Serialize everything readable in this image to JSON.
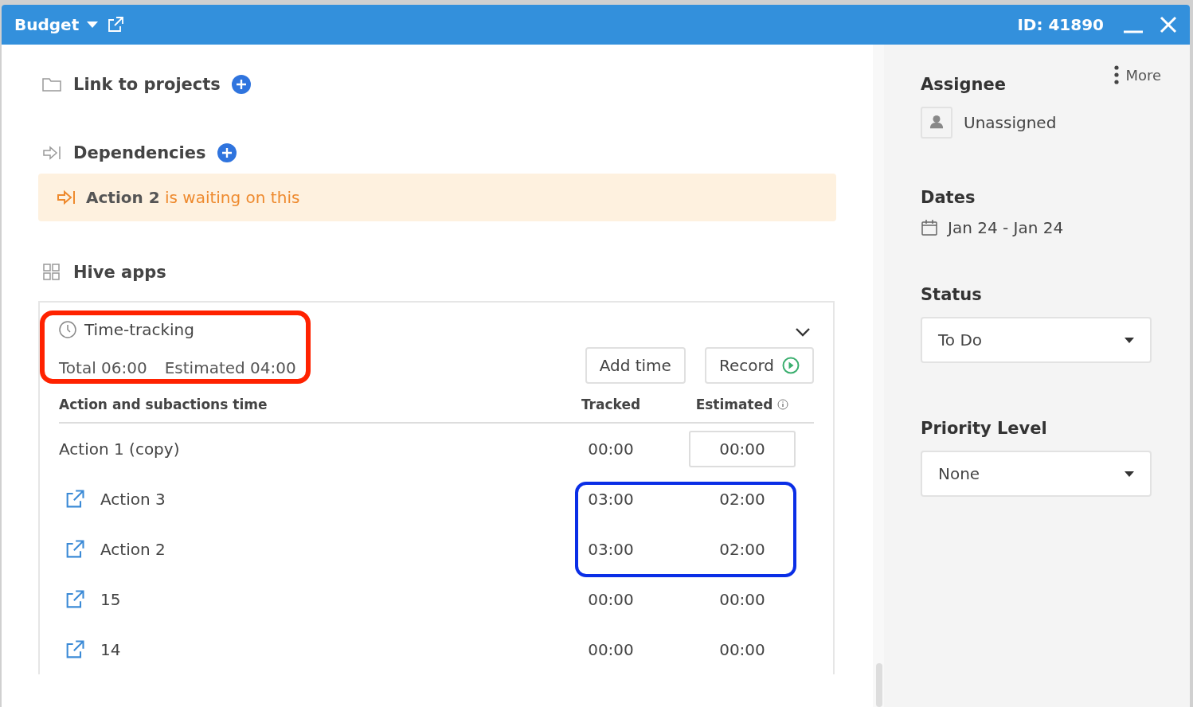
{
  "window": {
    "title": "Budget",
    "id_label": "ID: 41890"
  },
  "sections": [
    {
      "kind": "projects",
      "label": "Link to projects"
    },
    {
      "kind": "dependencies",
      "label": "Dependencies"
    }
  ],
  "dependency_notice": {
    "action": "Action 2",
    "text": "is waiting on this"
  },
  "apps_heading": "Hive apps",
  "time_tracking": {
    "title": "Time-tracking",
    "expanded": true,
    "total": "Total 06:00",
    "estimated": "Estimated 04:00",
    "highlighted": true,
    "buttons": [
      "Add time",
      "Record"
    ],
    "columns": [
      "Action and subactions time",
      "Tracked",
      "Estimated"
    ],
    "rows": [
      {
        "kind": "parent",
        "name": "Action 1 (copy)",
        "tracked": "00:00",
        "estimated": "00:00",
        "highlighted": false
      },
      {
        "kind": "subaction",
        "name": "Action 3",
        "tracked": "03:00",
        "estimated": "02:00",
        "highlighted": true
      },
      {
        "kind": "subaction",
        "name": "Action 2",
        "tracked": "03:00",
        "estimated": "02:00",
        "highlighted": true
      },
      {
        "kind": "subaction",
        "name": "15",
        "tracked": "00:00",
        "estimated": "00:00",
        "highlighted": false
      },
      {
        "kind": "subaction",
        "name": "14",
        "tracked": "00:00",
        "estimated": "00:00",
        "highlighted": false
      }
    ]
  },
  "sidebar": {
    "more": "More",
    "assignee_label": "Assignee",
    "assignee": "Unassigned",
    "dates_label": "Dates",
    "dates": "Jan 24 - Jan 24",
    "fields": [
      {
        "label": "Status",
        "value": "To Do"
      },
      {
        "label": "Priority Level",
        "value": "None"
      }
    ]
  }
}
